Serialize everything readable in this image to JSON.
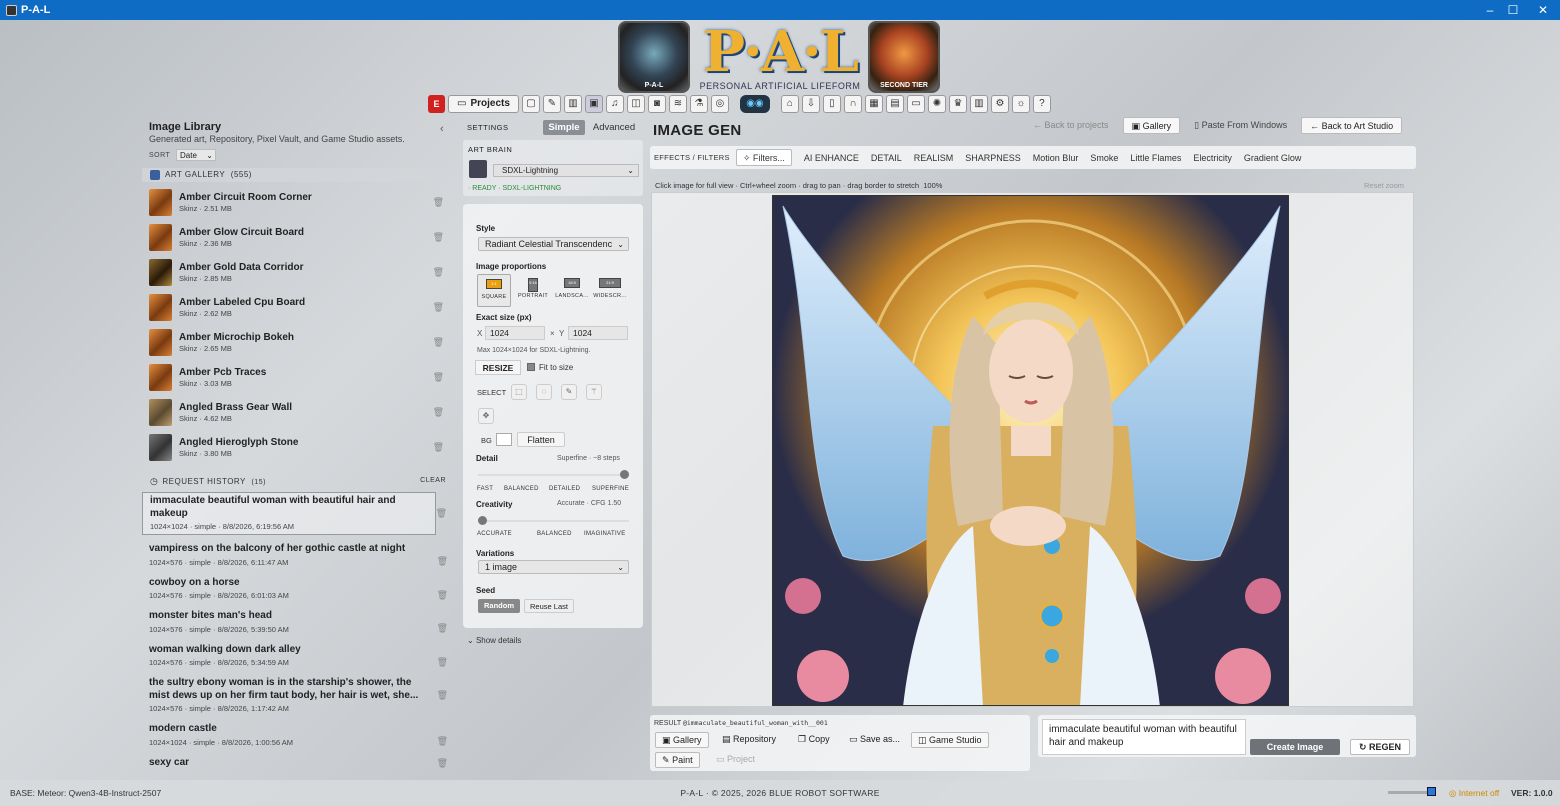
{
  "window": {
    "title": "P-A-L"
  },
  "header": {
    "logo_text": "P·A·L",
    "logo_subtitle": "PERSONAL ARTIFICIAL LIFEFORM",
    "left_medal": "P-A-L",
    "right_medal": "SECOND TIER",
    "e_badge": "E",
    "projects_label": "Projects"
  },
  "library": {
    "title": "Image Library",
    "subtitle": "Generated art, Repository, Pixel Vault, and Game Studio assets.",
    "sort_label": "SORT",
    "sort_value": "Date",
    "gallery_header": "ART GALLERY",
    "gallery_count": "(555)",
    "gallery_items": [
      {
        "name": "Amber Circuit Room Corner",
        "meta": "Skinz · 2.51 MB"
      },
      {
        "name": "Amber Glow Circuit Board",
        "meta": "Skinz · 2.36 MB"
      },
      {
        "name": "Amber Gold Data Corridor",
        "meta": "Skinz · 2.85 MB"
      },
      {
        "name": "Amber Labeled Cpu Board",
        "meta": "Skinz · 2.62 MB"
      },
      {
        "name": "Amber Microchip Bokeh",
        "meta": "Skinz · 2.65 MB"
      },
      {
        "name": "Amber Pcb Traces",
        "meta": "Skinz · 3.03 MB"
      },
      {
        "name": "Angled Brass Gear Wall",
        "meta": "Skinz · 4.62 MB"
      },
      {
        "name": "Angled Hieroglyph Stone",
        "meta": "Skinz · 3.80 MB"
      }
    ],
    "history_header": "REQUEST HISTORY",
    "history_count": "(15)",
    "history_clear": "CLEAR",
    "history_items": [
      {
        "text": "immaculate beautiful woman with beautiful hair and makeup",
        "meta": "1024×1024 · simple · 8/8/2026, 6:19:56 AM"
      },
      {
        "text": "vampiress on the balcony of her gothic castle at night",
        "meta": "1024×576 · simple · 8/8/2026, 6:11:47 AM"
      },
      {
        "text": "cowboy on a horse",
        "meta": "1024×576 · simple · 8/8/2026, 6:01:03 AM"
      },
      {
        "text": "monster bites man's head",
        "meta": "1024×576 · simple · 8/8/2026, 5:39:50 AM"
      },
      {
        "text": "woman walking down dark alley",
        "meta": "1024×576 · simple · 8/8/2026, 5:34:59 AM"
      },
      {
        "text": "the sultry ebony woman is in the starship's shower, the mist dews up on her firm taut body, her hair is wet, she...",
        "meta": "1024×576 · simple · 8/8/2026, 1:17:42 AM"
      },
      {
        "text": "modern castle",
        "meta": "1024×1024 · simple · 8/8/2026, 1:00:56 AM"
      },
      {
        "text": "sexy car",
        "meta": ""
      }
    ]
  },
  "settings": {
    "label": "SETTINGS",
    "tab_simple": "Simple",
    "tab_advanced": "Advanced",
    "art_brain_label": "ART BRAIN",
    "model": "SDXL-Lightning",
    "status": "· READY · SDXL-LIGHTNING",
    "style_label": "Style",
    "style_value": "Radiant Celestial Transcendenc",
    "proportions_label": "Image proportions",
    "proportions": [
      {
        "icon": "1:1",
        "label": "SQUARE"
      },
      {
        "icon": "9:16",
        "label": "PORTRAIT"
      },
      {
        "icon": "16:9",
        "label": "LANDSCA..."
      },
      {
        "icon": "21:9",
        "label": "WIDESCR..."
      }
    ],
    "exact_size_label": "Exact size (px)",
    "x_label": "X",
    "x_value": "1024",
    "y_label": "Y",
    "y_value": "1024",
    "max_note": "Max 1024×1024 for SDXL-Lightning.",
    "resize_label": "RESIZE",
    "fit_label": "Fit to size",
    "select_label": "SELECT",
    "bg_label": "BG",
    "flatten_label": "Flatten",
    "detail_label": "Detail",
    "detail_value": "Superfine · ~8 steps",
    "detail_level": 1.0,
    "detail_ticks": [
      "FAST",
      "BALANCED",
      "DETAILED",
      "SUPERFINE"
    ],
    "creativity_label": "Creativity",
    "creativity_value": "Accurate · CFG 1.50",
    "creativity_level": 0.0,
    "creativity_ticks": [
      "ACCURATE",
      "BALANCED",
      "IMAGINATIVE"
    ],
    "variations_label": "Variations",
    "variations_value": "1 image",
    "seed_label": "Seed",
    "seed_random": "Random",
    "seed_reuse": "Reuse Last",
    "show_details": "Show details"
  },
  "imagegen": {
    "title": "IMAGE GEN",
    "back_projects": "Back to projects",
    "gallery": "Gallery",
    "paste": "Paste From Windows",
    "back_studio": "Back to Art Studio",
    "effects_label": "EFFECTS / FILTERS",
    "filters": "Filters...",
    "effects": [
      "AI ENHANCE",
      "DETAIL",
      "REALISM",
      "SHARPNESS",
      "Motion Blur",
      "Smoke",
      "Little Flames",
      "Electricity",
      "Gradient Glow"
    ],
    "hint": "Click image for full view · Ctrl+wheel zoom · drag to pan · drag border to stretch",
    "zoom": "100%",
    "reset_zoom": "Reset zoom"
  },
  "result": {
    "label": "RESULT",
    "filename": "@immaculate_beautiful_woman_with__001",
    "gallery": "Gallery",
    "repository": "Repository",
    "copy": "Copy",
    "save_as": "Save as...",
    "game_studio": "Game Studio",
    "paint": "Paint",
    "project": "Project"
  },
  "prompt": {
    "text": "immaculate beautiful woman with beautiful hair and makeup",
    "create": "Create Image",
    "regen": "REGEN"
  },
  "status": {
    "base": "BASE: Meteor: Qwen3-4B-Instruct-2507",
    "center": "P-A-L · © 2025, 2026 BLUE ROBOT SOFTWARE",
    "internet": "Internet off",
    "version": "VER: 1.0.0"
  },
  "colors": {
    "titlebar": "#0f6cc4",
    "logo_gold": "#f0b030",
    "ready_green": "#2a8a3a",
    "internet_off": "#c98a00"
  }
}
